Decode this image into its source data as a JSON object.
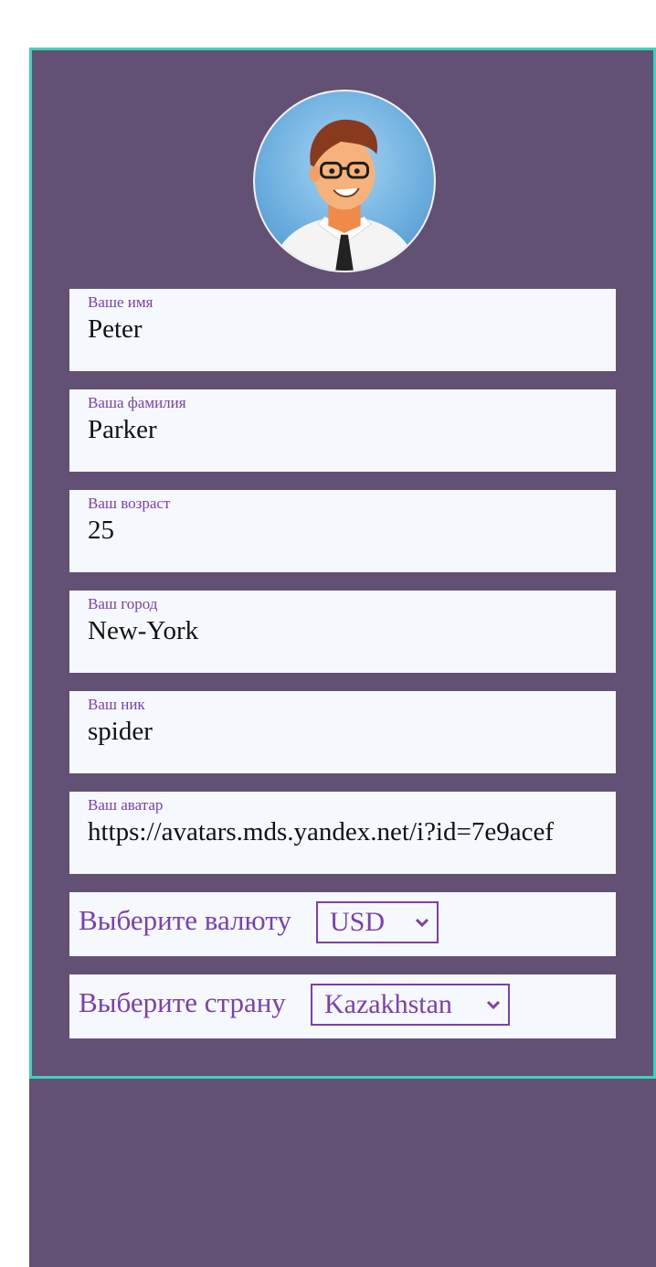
{
  "avatar": {
    "alt": "avatar"
  },
  "fields": [
    {
      "label": "Ваше имя",
      "value": "Peter"
    },
    {
      "label": "Ваша фамилия",
      "value": "Parker"
    },
    {
      "label": "Ваш возраст",
      "value": "25"
    },
    {
      "label": "Ваш город",
      "value": "New-York"
    },
    {
      "label": "Ваш ник",
      "value": "spider"
    },
    {
      "label": "Ваш аватар",
      "value": "https://avatars.mds.yandex.net/i?id=7e9acef"
    }
  ],
  "currency": {
    "label": "Выберите валюту",
    "selected": "USD"
  },
  "country": {
    "label": "Выберите страну",
    "selected": "Kazakhstan"
  },
  "colors": {
    "accent": "#7b3fb3",
    "background": "#625075",
    "card_border": "#3cd4b8",
    "field_bg": "#f5f8fd"
  },
  "icons": {
    "select_arrow": "chevron-down-icon"
  }
}
